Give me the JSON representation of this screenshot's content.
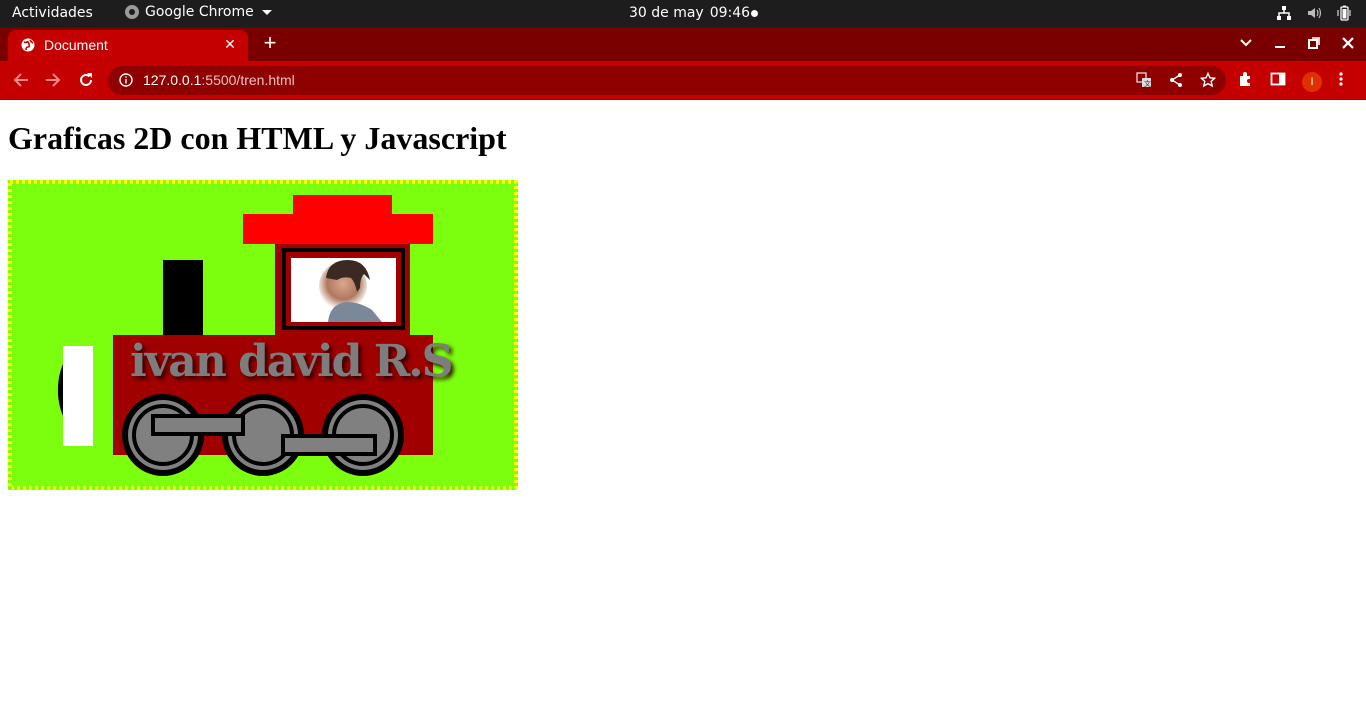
{
  "system_bar": {
    "activities": "Actividades",
    "app_name": "Google Chrome",
    "date": "30 de may",
    "time": "09:46"
  },
  "browser": {
    "tab_title": "Document",
    "url_host": "127.0.0.1",
    "url_rest": ":5500/tren.html",
    "profile_initial": "I"
  },
  "page": {
    "heading": "Graficas 2D con HTML y Javascript",
    "canvas_text": "ivan david R.S"
  },
  "colors": {
    "canvas_bg": "#7cff0f",
    "canvas_border": "#ffff00",
    "train_body": "#a00000",
    "roof": "#ff0000",
    "wheel": "#808080",
    "chrome_frame": "#c40000"
  }
}
